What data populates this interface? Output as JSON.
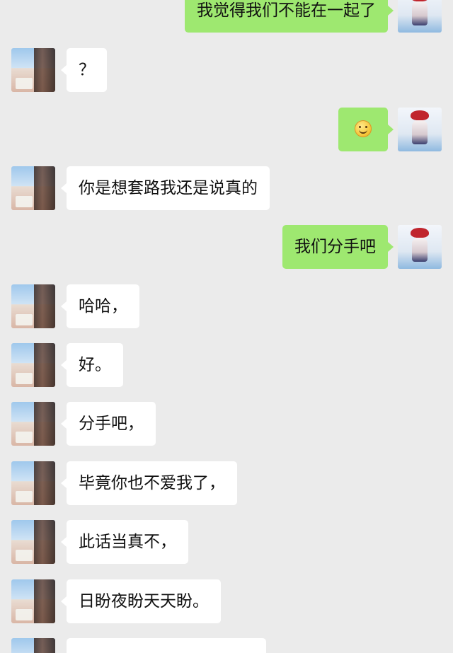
{
  "messages": [
    {
      "from": "me",
      "text": "我觉得我们不能在一起了"
    },
    {
      "from": "other",
      "text": "？"
    },
    {
      "from": "me",
      "emoji": "smiley-icon"
    },
    {
      "from": "other",
      "text": "你是想套路我还是说真的"
    },
    {
      "from": "me",
      "text": "我们分手吧"
    },
    {
      "from": "other",
      "text": "哈哈，"
    },
    {
      "from": "other",
      "text": "好。"
    },
    {
      "from": "other",
      "text": "分手吧，"
    },
    {
      "from": "other",
      "text": "毕竟你也不爱我了，"
    },
    {
      "from": "other",
      "text": "此话当真不，"
    },
    {
      "from": "other",
      "text": "日盼夜盼天天盼。"
    }
  ],
  "colors": {
    "background": "#ebebeb",
    "my_bubble": "#9ee870",
    "their_bubble": "#ffffff"
  }
}
